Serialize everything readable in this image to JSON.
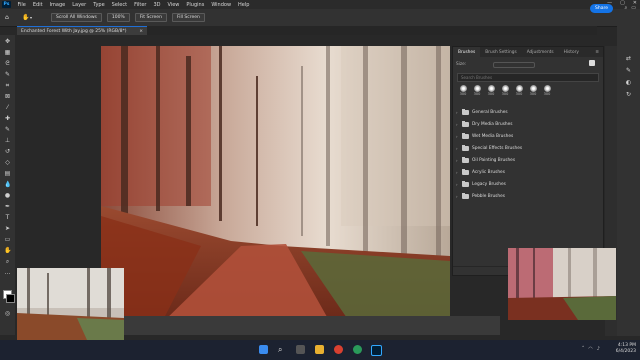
{
  "app": {
    "logo_text": "Ps"
  },
  "menu": [
    "File",
    "Edit",
    "Image",
    "Layer",
    "Type",
    "Select",
    "Filter",
    "3D",
    "View",
    "Plugins",
    "Window",
    "Help"
  ],
  "window_controls": [
    "—",
    "▢",
    "✕"
  ],
  "options_bar": {
    "home_icon": "home-icon",
    "scroll_all": "Scroll All Windows",
    "zoom": "100%",
    "fit_screen": "Fit Screen",
    "fill_screen": "Fill Screen"
  },
  "share": {
    "label": "Share"
  },
  "document": {
    "tab_title": "Enchanted Forest With Jay.jpg @ 25% (RGB/8*)",
    "close": "×"
  },
  "brushes_panel": {
    "tabs": [
      "Brushes",
      "Brush Settings",
      "Adjustments",
      "History"
    ],
    "size_label": "Size:",
    "search_placeholder": "Search Brushes",
    "recent_sizes": [
      "300",
      "300",
      "300",
      "300",
      "300",
      "300",
      "300"
    ],
    "folders": [
      "General Brushes",
      "Dry Media Brushes",
      "Wet Media Brushes",
      "Special Effects Brushes",
      "Oil Painting Brushes",
      "Acrylic Brushes",
      "Legacy Brushes",
      "Pebble Brushes"
    ]
  },
  "taskbar": {
    "time": "4:13 PM",
    "date": "6/4/2023"
  },
  "colors": {
    "accent": "#1473e6",
    "panel_bg": "#323232",
    "app_bg": "#282828",
    "taskbar_bg": "#1c2230"
  }
}
